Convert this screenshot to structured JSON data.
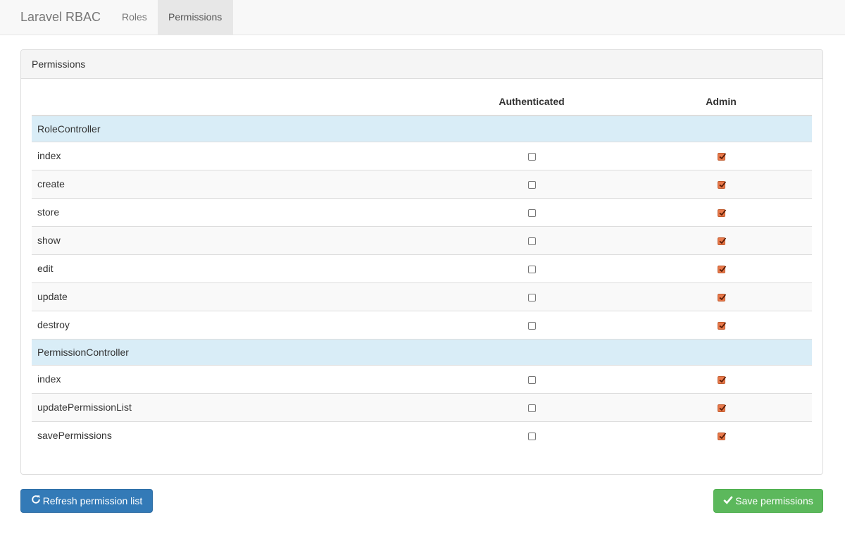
{
  "navbar": {
    "brand": "Laravel RBAC",
    "links": [
      {
        "label": "Roles",
        "active": false
      },
      {
        "label": "Permissions",
        "active": true
      }
    ]
  },
  "panel": {
    "title": "Permissions"
  },
  "table": {
    "columns": [
      "",
      "Authenticated",
      "Admin"
    ],
    "groups": [
      {
        "name": "RoleController",
        "rows": [
          {
            "action": "index",
            "authenticated": false,
            "admin": true
          },
          {
            "action": "create",
            "authenticated": false,
            "admin": true
          },
          {
            "action": "store",
            "authenticated": false,
            "admin": true
          },
          {
            "action": "show",
            "authenticated": false,
            "admin": true
          },
          {
            "action": "edit",
            "authenticated": false,
            "admin": true
          },
          {
            "action": "update",
            "authenticated": false,
            "admin": true
          },
          {
            "action": "destroy",
            "authenticated": false,
            "admin": true
          }
        ]
      },
      {
        "name": "PermissionController",
        "rows": [
          {
            "action": "index",
            "authenticated": false,
            "admin": true
          },
          {
            "action": "updatePermissionList",
            "authenticated": false,
            "admin": true
          },
          {
            "action": "savePermissions",
            "authenticated": false,
            "admin": true
          }
        ]
      }
    ]
  },
  "buttons": {
    "refresh": {
      "label": "Refresh permission list",
      "icon": "refresh-icon"
    },
    "save": {
      "label": "Save permissions",
      "icon": "check-icon"
    }
  },
  "colors": {
    "navbar_bg": "#f8f8f8",
    "group_row_bg": "#d9edf7",
    "primary": "#337ab7",
    "success": "#5cb85c",
    "checkbox_checked": "#e8784a"
  }
}
